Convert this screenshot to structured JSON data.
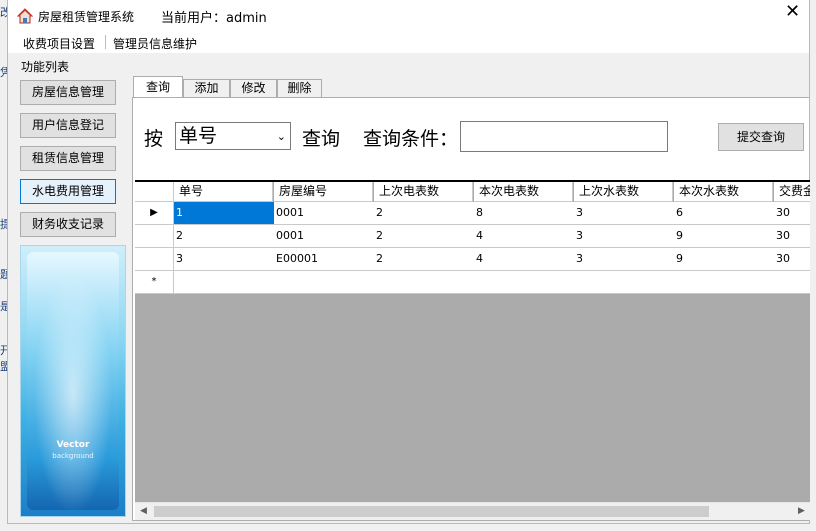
{
  "window": {
    "title": "房屋租赁管理系统",
    "current_user_label": "当前用户：admin",
    "close_label": "✕"
  },
  "menu": {
    "items": [
      "收费项目设置",
      "管理员信息维护"
    ]
  },
  "sidebar": {
    "title": "功能列表",
    "buttons": [
      "房屋信息管理",
      "用户信息登记",
      "租赁信息管理",
      "水电费用管理",
      "财务收支记录"
    ],
    "banner_title": "Vector",
    "banner_subtitle": "background"
  },
  "tabs": [
    "查询",
    "添加",
    "修改",
    "删除"
  ],
  "query": {
    "by_label": "按",
    "field_value": "单号",
    "query_label": "查询",
    "condition_label": "查询条件：",
    "condition_value": "",
    "submit_label": "提交查询"
  },
  "table": {
    "columns": [
      "单号",
      "房屋编号",
      "上次电表数",
      "本次电表数",
      "上次水表数",
      "本次水表数",
      "交费金"
    ],
    "rows": [
      [
        "1",
        "0001",
        "2",
        "8",
        "3",
        "6",
        "30"
      ],
      [
        "2",
        "0001",
        "2",
        "4",
        "3",
        "9",
        "30"
      ],
      [
        "3",
        "E00001",
        "2",
        "4",
        "3",
        "9",
        "30"
      ]
    ],
    "current_row_marker": "▶",
    "new_row_marker": "*"
  },
  "background_fragments": [
    "改",
    "凭",
    "提",
    "题",
    "是",
    "开",
    "盟"
  ],
  "colors": {
    "selection": "#0078d7",
    "grid_empty": "#ababab",
    "window_bg": "#f0f0f0"
  }
}
